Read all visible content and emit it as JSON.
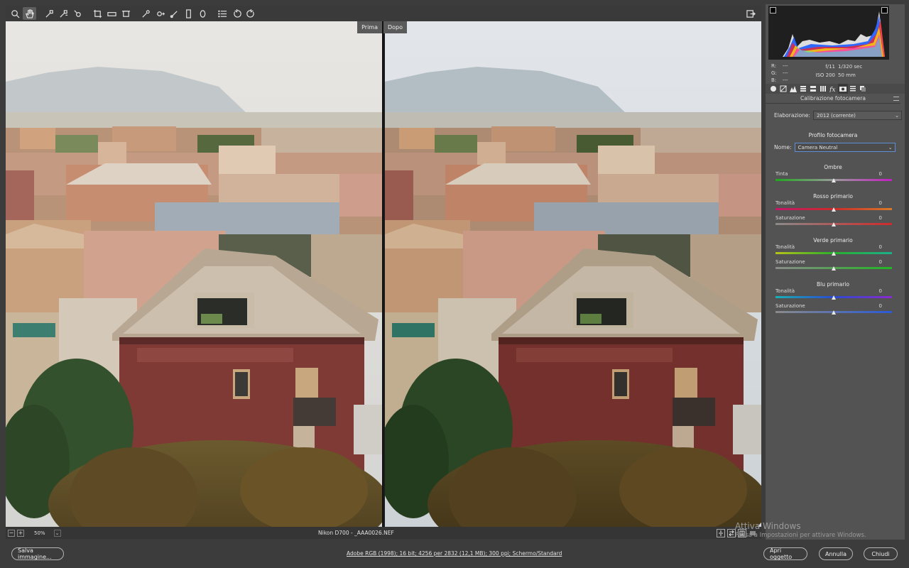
{
  "toolbar": {
    "tools": [
      "zoom-icon",
      "hand-icon",
      "white-balance-icon",
      "color-sampler-icon",
      "target-adjust-icon",
      "crop-icon",
      "straighten-icon",
      "transform-icon",
      "spot-removal-icon",
      "red-eye-icon",
      "adjustment-brush-icon",
      "graduated-filter-icon",
      "radial-filter-icon",
      "preferences-icon",
      "rotate-ccw-icon",
      "rotate-cw-icon"
    ],
    "export_icon": "export-icon"
  },
  "preview": {
    "before_label": "Prima",
    "after_label": "Dopo"
  },
  "status": {
    "zoom_out": "−",
    "zoom_in": "+",
    "zoom": "50%",
    "filename": "Nikon D700  -  _AAA0026.NEF"
  },
  "histogram": {
    "r_label": "R:",
    "r_val": "---",
    "g_label": "G:",
    "g_val": "---",
    "b_label": "B:",
    "b_val": "---",
    "aperture": "f/11",
    "shutter": "1/320 sec",
    "iso": "ISO 200",
    "focal": "50 mm"
  },
  "panel": {
    "title": "Calibrazione fotocamera",
    "elaborazione_label": "Elaborazione:",
    "elaborazione_value": "2012 (corrente)",
    "profilo_head": "Profilo fotocamera",
    "nome_label": "Nome:",
    "nome_value": "Camera Neutral",
    "ombre_head": "Ombre",
    "tinta_label": "Tinta",
    "tinta_val": "0",
    "rosso_head": "Rosso primario",
    "rosso_ton_label": "Tonalità",
    "rosso_ton_val": "0",
    "rosso_sat_label": "Saturazione",
    "rosso_sat_val": "0",
    "verde_head": "Verde primario",
    "verde_ton_label": "Tonalità",
    "verde_ton_val": "0",
    "verde_sat_label": "Saturazione",
    "verde_sat_val": "0",
    "blu_head": "Blu primario",
    "blu_ton_label": "Tonalità",
    "blu_ton_val": "0",
    "blu_sat_label": "Saturazione",
    "blu_sat_val": "0"
  },
  "bottom": {
    "save": "Salva immagine...",
    "workflow": "Adobe RGB (1998); 16 bit; 4256 per 2832 (12,1 MB); 300 ppi; Schermo/Standard",
    "open": "Apri oggetto",
    "cancel": "Annulla",
    "close": "Chiudi"
  },
  "watermark": {
    "line1": "Attiva Windows",
    "line2": "Passa a Impostazioni per attivare Windows."
  }
}
